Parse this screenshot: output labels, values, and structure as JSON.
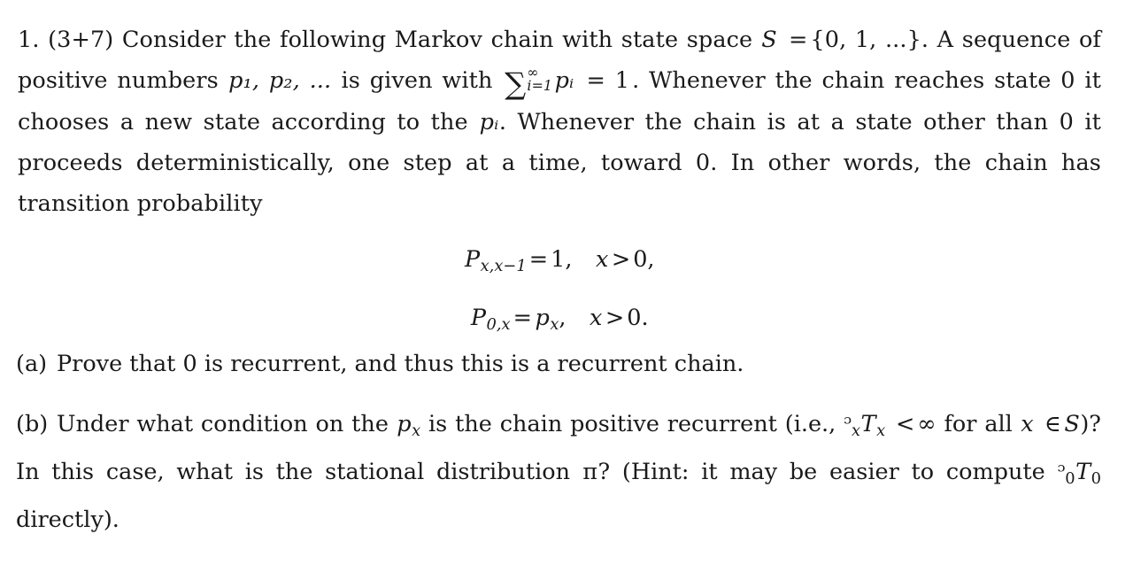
{
  "document": {
    "kind": "math-homework-problem",
    "problem_number": "1.",
    "points": "(3+7)",
    "statement": {
      "line1_a": "Consider the following Markov chain with state space",
      "state_space_var": "S",
      "equals": "=",
      "state_space_set": "{0, 1, ...}",
      "line1_b": ". A sequence",
      "line2_a": "of positive numbers",
      "p_list": "p₁, p₂, ...",
      "line2_b": "is given with",
      "sum_symbol": "∑",
      "sum_lower": "i=1",
      "sum_upper": "∞",
      "sum_term": "pᵢ",
      "sum_equals": "= 1",
      "line2_c": ". Whenever the chain reaches state",
      "line3": "0 it chooses a new state according to the",
      "p_i": "pᵢ",
      "line3_b": ". Whenever the chain is at a state other than 0",
      "line4": "it proceeds deterministically, one step at a time, toward 0. In other words, the chain has",
      "line5": "transition probability"
    },
    "equations": [
      {
        "name": "transition-down",
        "lhs_base": "P",
        "lhs_sub": "x,x−1",
        "rel": "=",
        "rhs": "1,",
        "condition_var": "x",
        "condition_rel": ">",
        "condition_val": "0,"
      },
      {
        "name": "transition-from-zero",
        "lhs_base": "P",
        "lhs_sub": "0,x",
        "rel": "=",
        "rhs_base": "p",
        "rhs_sub": "x",
        "rhs_punct": ",",
        "condition_var": "x",
        "condition_rel": ">",
        "condition_val": "0."
      }
    ],
    "parts": [
      {
        "label": "(a)",
        "text": "Prove that 0 is recurrent, and thus this is a recurrent chain."
      },
      {
        "label": "(b)",
        "text_1": "Under what condition on the",
        "var_px_base": "p",
        "var_px_sub": "x",
        "text_2": "is the chain positive recurrent (i.e.,",
        "expect_E": "ᴇ",
        "expect_E_glyph": "ᵓ",
        "expect_sub": "x",
        "expect_T": "T",
        "expect_T_sub": "x",
        "lt": "<",
        "infinity": "∞",
        "text_3": "for all",
        "var_x": "x",
        "member": "∈",
        "set_S": "S",
        "text_4": ")? In this case, what is the stational distribution",
        "pi": "π",
        "text_5": "? (Hint: it may be easier to compute",
        "compute_E": "ᵓ",
        "compute_E_sub": "0",
        "compute_T": "T",
        "compute_T_sub": "0",
        "text_6": "directly)."
      }
    ]
  },
  "style": {
    "text_color": "#1a1a1a",
    "background": "#ffffff"
  }
}
